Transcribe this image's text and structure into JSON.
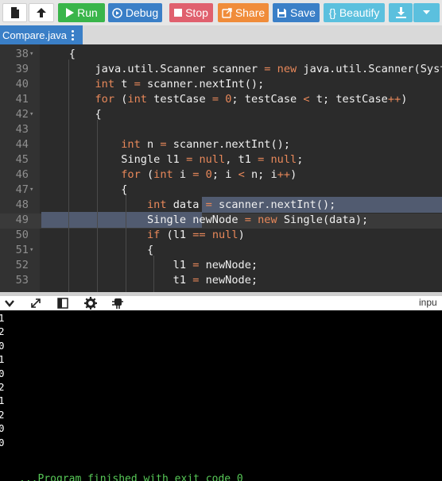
{
  "toolbar": {
    "run_label": "Run",
    "debug_label": "Debug",
    "stop_label": "Stop",
    "share_label": "Share",
    "save_label": "Save",
    "beautify_label": "{} Beautify",
    "colors": {
      "run": "#39b54a",
      "debug": "#3a7fc7",
      "stop": "#e0606e",
      "share": "#f08c3a",
      "save": "#3a7fc7",
      "beautify": "#5bc0de",
      "download": "#5bc0de"
    }
  },
  "tab": {
    "file_name": "Compare.java"
  },
  "editor": {
    "lines": [
      {
        "num": "38",
        "fold": true,
        "text": "    {"
      },
      {
        "num": "39",
        "fold": false,
        "text": "        java.util.Scanner scanner = new java.util.Scanner(System.in);"
      },
      {
        "num": "40",
        "fold": false,
        "text": "        int t = scanner.nextInt();"
      },
      {
        "num": "41",
        "fold": false,
        "text": "        for (int testCase = 0; testCase < t; testCase++)"
      },
      {
        "num": "42",
        "fold": true,
        "text": "        {"
      },
      {
        "num": "43",
        "fold": false,
        "text": ""
      },
      {
        "num": "44",
        "fold": false,
        "text": "            int n = scanner.nextInt();"
      },
      {
        "num": "45",
        "fold": false,
        "text": "            Single l1 = null, t1 = null;"
      },
      {
        "num": "46",
        "fold": false,
        "text": "            for (int i = 0; i < n; i++)"
      },
      {
        "num": "47",
        "fold": true,
        "text": "            {"
      },
      {
        "num": "48",
        "fold": false,
        "text": "                int data = scanner.nextInt();"
      },
      {
        "num": "49",
        "fold": false,
        "text": "                Single newNode = new Single(data);"
      },
      {
        "num": "50",
        "fold": false,
        "text": "                if (l1 == null)"
      },
      {
        "num": "51",
        "fold": true,
        "text": "                {"
      },
      {
        "num": "52",
        "fold": false,
        "text": "                    l1 = newNode;"
      },
      {
        "num": "53",
        "fold": false,
        "text": "                    t1 = newNode;"
      }
    ]
  },
  "io": {
    "label": "inpu",
    "icons": [
      "chevron-down-icon",
      "expand-icon",
      "layout-icon",
      "gear-icon",
      "debug-icon"
    ]
  },
  "console": {
    "output_lines": [
      "1",
      "2",
      "0",
      "1",
      "0",
      "2",
      "1",
      "2",
      "0",
      "0"
    ],
    "finish_text": "...Program finished with exit code 0"
  }
}
